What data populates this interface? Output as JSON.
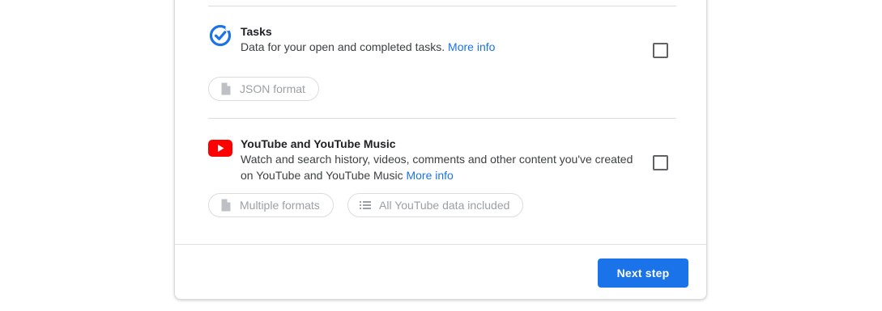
{
  "products": [
    {
      "title": "Tasks",
      "description": "Data for your open and completed tasks.",
      "more_info": "More info",
      "icon": "tasks-icon",
      "chips": [
        {
          "label": "JSON format",
          "icon": "file-icon"
        }
      ],
      "checked": false
    },
    {
      "title": "YouTube and YouTube Music",
      "description": "Watch and search history, videos, comments and other content you've created on YouTube and YouTube Music",
      "more_info": "More info",
      "icon": "youtube-icon",
      "chips": [
        {
          "label": "Multiple formats",
          "icon": "file-icon"
        },
        {
          "label": "All YouTube data included",
          "icon": "list-icon"
        }
      ],
      "checked": false
    }
  ],
  "footer": {
    "next_label": "Next step"
  },
  "colors": {
    "accent": "#1a73e8",
    "youtube_red": "#ff0000",
    "chip_text": "#9aa0a6"
  }
}
